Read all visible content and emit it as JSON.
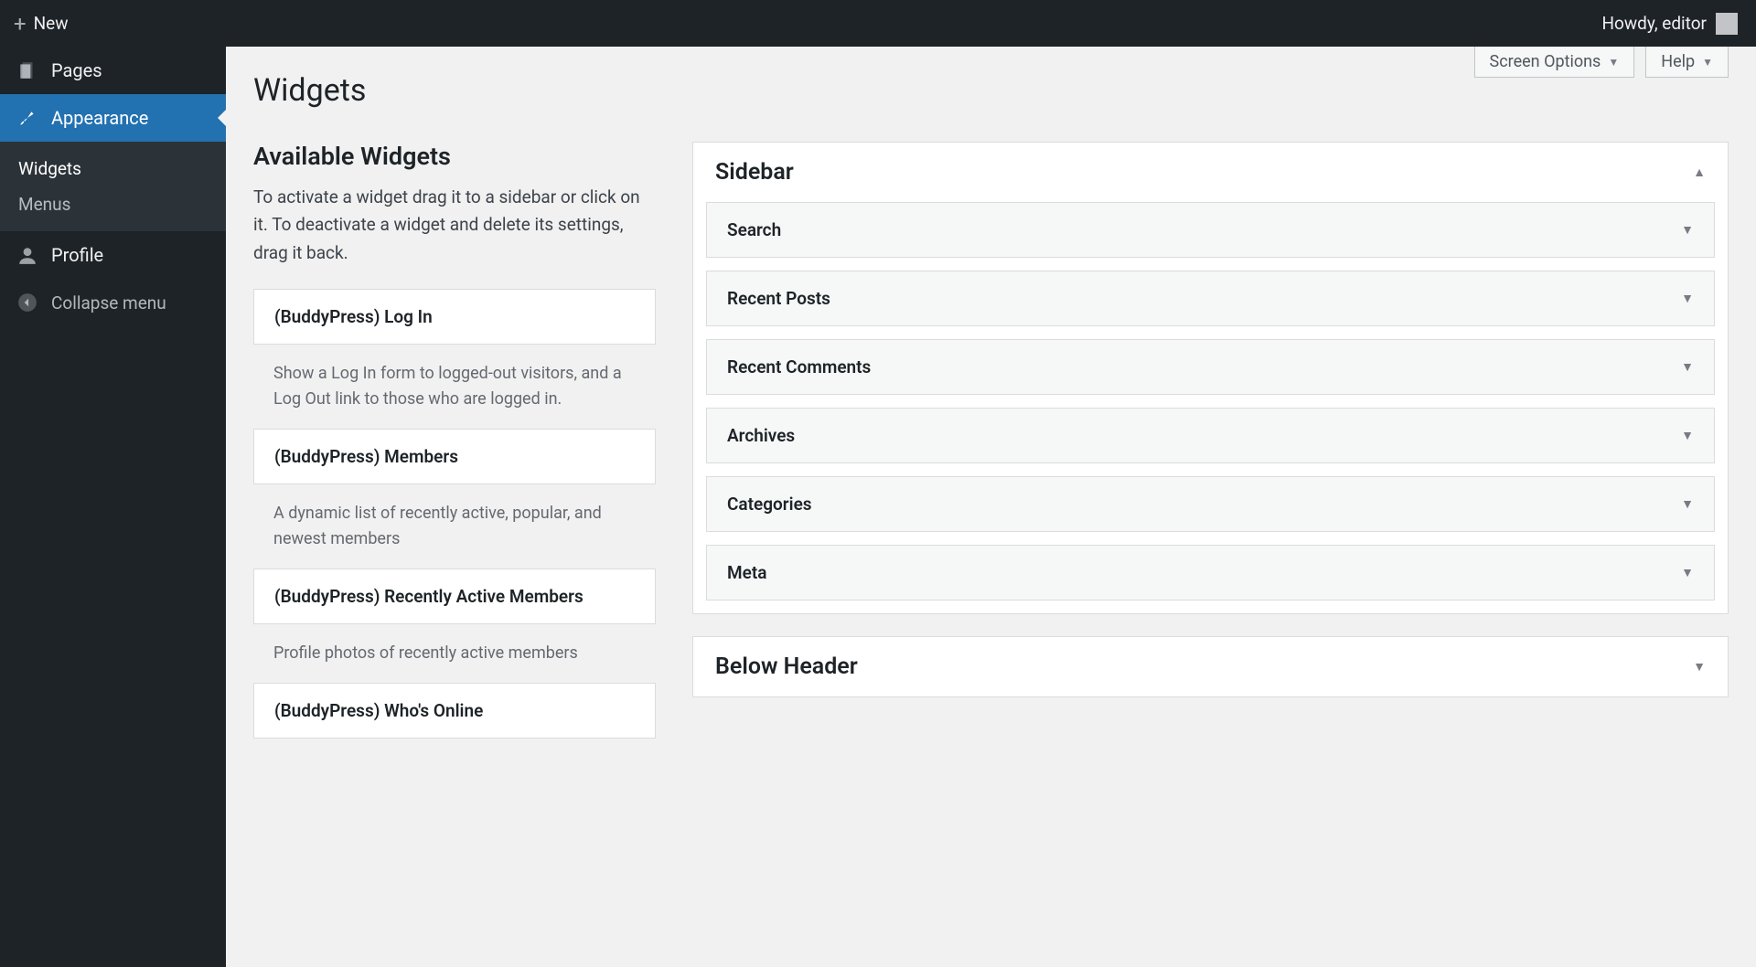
{
  "topbar": {
    "new_label": "New",
    "howdy": "Howdy, editor"
  },
  "sidebar": {
    "pages": "Pages",
    "appearance": "Appearance",
    "submenu": {
      "widgets": "Widgets",
      "menus": "Menus"
    },
    "profile": "Profile",
    "collapse": "Collapse menu"
  },
  "controls": {
    "screen_options": "Screen Options",
    "help": "Help"
  },
  "page": {
    "title": "Widgets",
    "available_title": "Available Widgets",
    "available_desc": "To activate a widget drag it to a sidebar or click on it. To deactivate a widget and delete its settings, drag it back."
  },
  "available_widgets": [
    {
      "title": "(BuddyPress) Log In",
      "desc": "Show a Log In form to logged-out visitors, and a Log Out link to those who are logged in."
    },
    {
      "title": "(BuddyPress) Members",
      "desc": "A dynamic list of recently active, popular, and newest members"
    },
    {
      "title": "(BuddyPress) Recently Active Members",
      "desc": "Profile photos of recently active members"
    },
    {
      "title": "(BuddyPress) Who's Online",
      "desc": ""
    }
  ],
  "widget_areas": [
    {
      "name": "Sidebar",
      "expanded": true,
      "widgets": [
        "Search",
        "Recent Posts",
        "Recent Comments",
        "Archives",
        "Categories",
        "Meta"
      ]
    },
    {
      "name": "Below Header",
      "expanded": false,
      "widgets": []
    }
  ]
}
